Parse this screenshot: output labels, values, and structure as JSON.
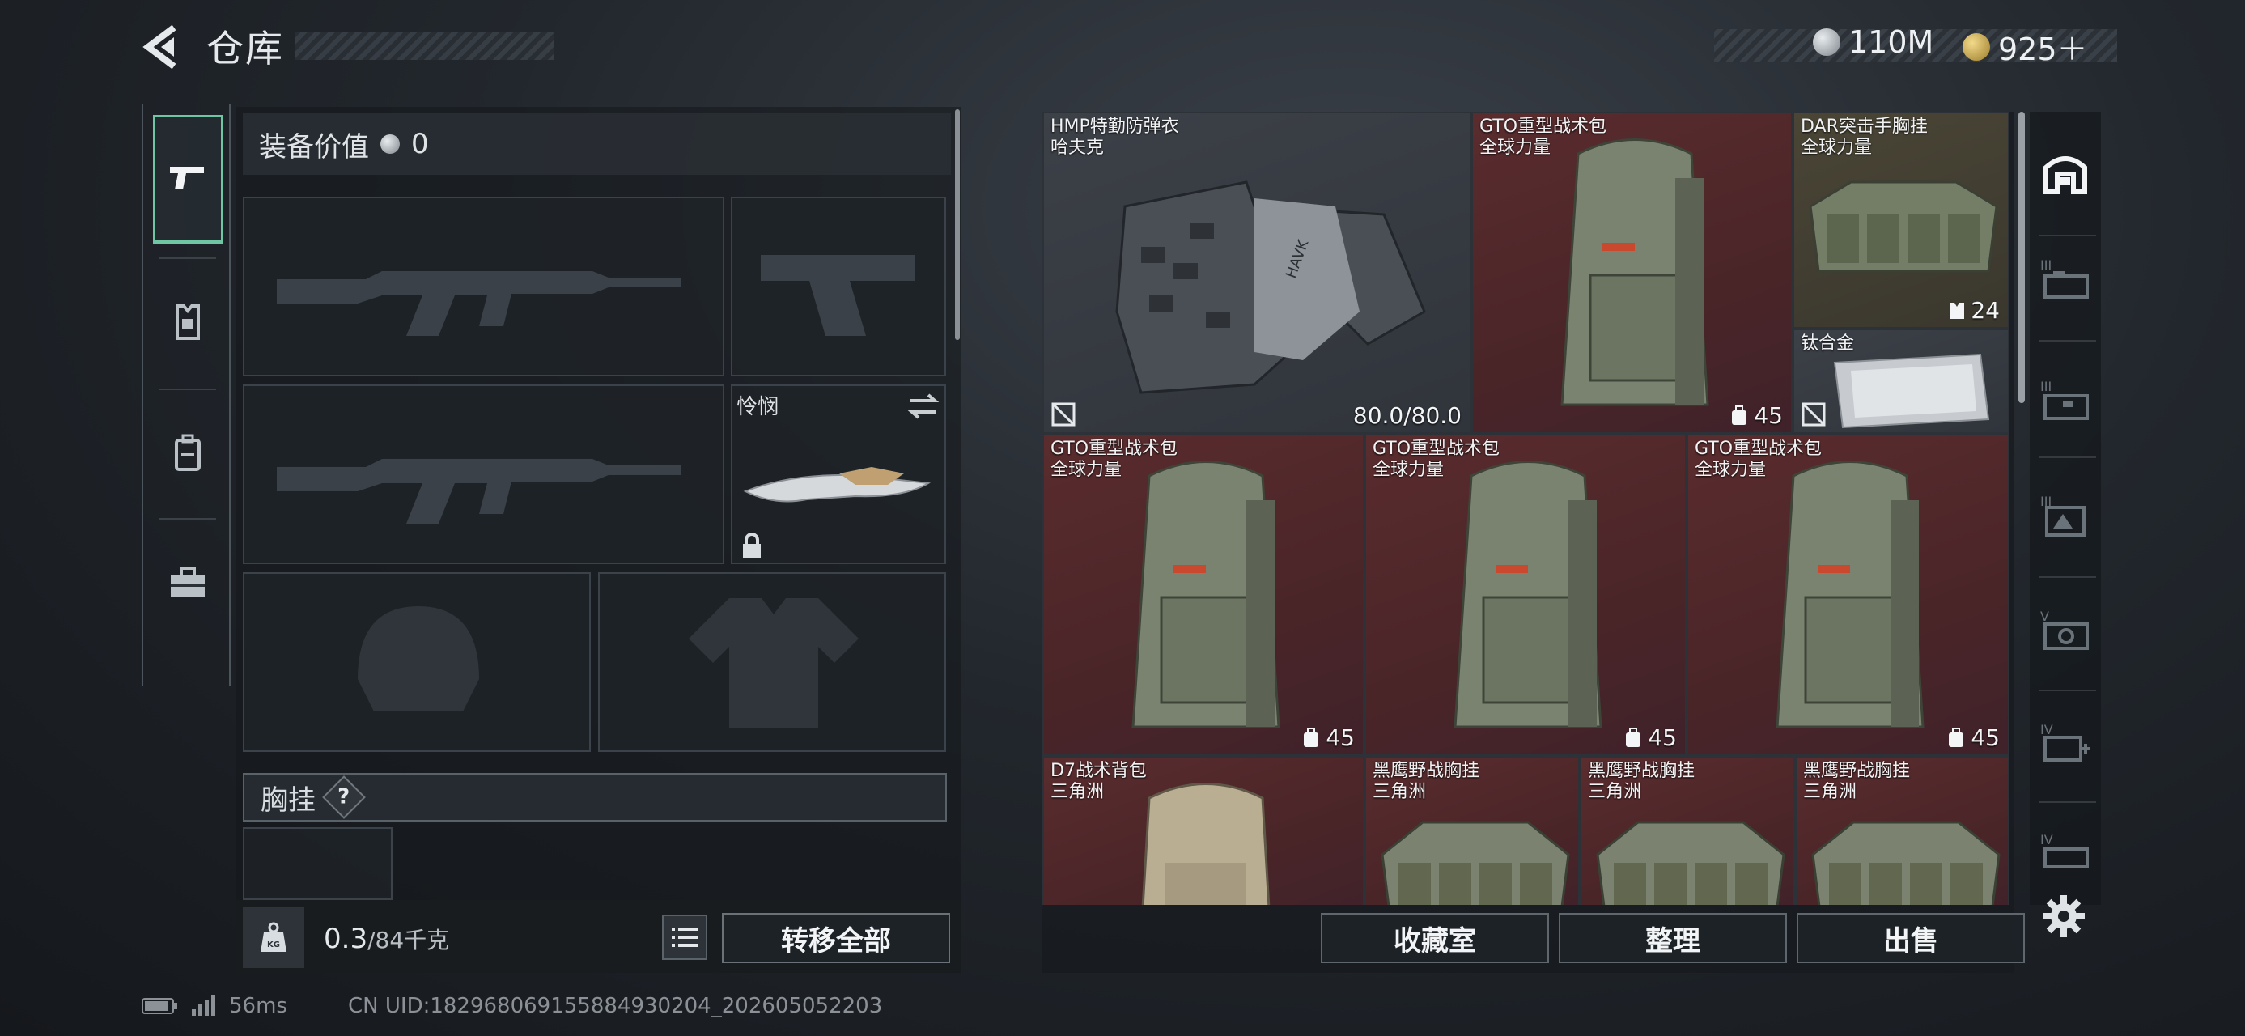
{
  "header": {
    "title": "仓库"
  },
  "currency": {
    "coins": "110M",
    "tokens": "925＋"
  },
  "loadout": {
    "equip_value_label": "装备价值",
    "equip_value": "0",
    "knife_label": "怜悯",
    "chest_label": "胸挂",
    "help": "?"
  },
  "weight": {
    "current": "0.3",
    "max": "/84千克"
  },
  "buttons": {
    "transfer_all": "转移全部",
    "collection": "收藏室",
    "organize": "整理",
    "sell": "出售"
  },
  "status": {
    "ping": "56ms",
    "uid": "CN UID:182968069155884930204_202605052203"
  },
  "stash": {
    "items": [
      {
        "name": "HMP特勤防弹衣",
        "sub": "哈夫克",
        "stat": "80.0/80.0"
      },
      {
        "name": "GTO重型战术包",
        "sub": "全球力量",
        "stat": "45"
      },
      {
        "name": "DAR突击手胸挂",
        "sub": "全球力量",
        "stat": "24"
      },
      {
        "name": "钛合金",
        "sub": "",
        "stat": ""
      },
      {
        "name": "GTO重型战术包",
        "sub": "全球力量",
        "stat": "45"
      },
      {
        "name": "GTO重型战术包",
        "sub": "全球力量",
        "stat": "45"
      },
      {
        "name": "GTO重型战术包",
        "sub": "全球力量",
        "stat": "45"
      },
      {
        "name": "D7战术背包",
        "sub": "三角洲",
        "stat": ""
      },
      {
        "name": "黑鹰野战胸挂",
        "sub": "三角洲",
        "stat": ""
      },
      {
        "name": "黑鹰野战胸挂",
        "sub": "三角洲",
        "stat": ""
      },
      {
        "name": "黑鹰野战胸挂",
        "sub": "三角洲",
        "stat": ""
      }
    ]
  },
  "right_rail": {
    "tiers": [
      "III",
      "III",
      "III",
      "V",
      "IV",
      "IV"
    ]
  },
  "colors": {
    "accent": "#6fc6a2",
    "rare_bg": "#5a2c2e",
    "panel": "#1e2328"
  }
}
